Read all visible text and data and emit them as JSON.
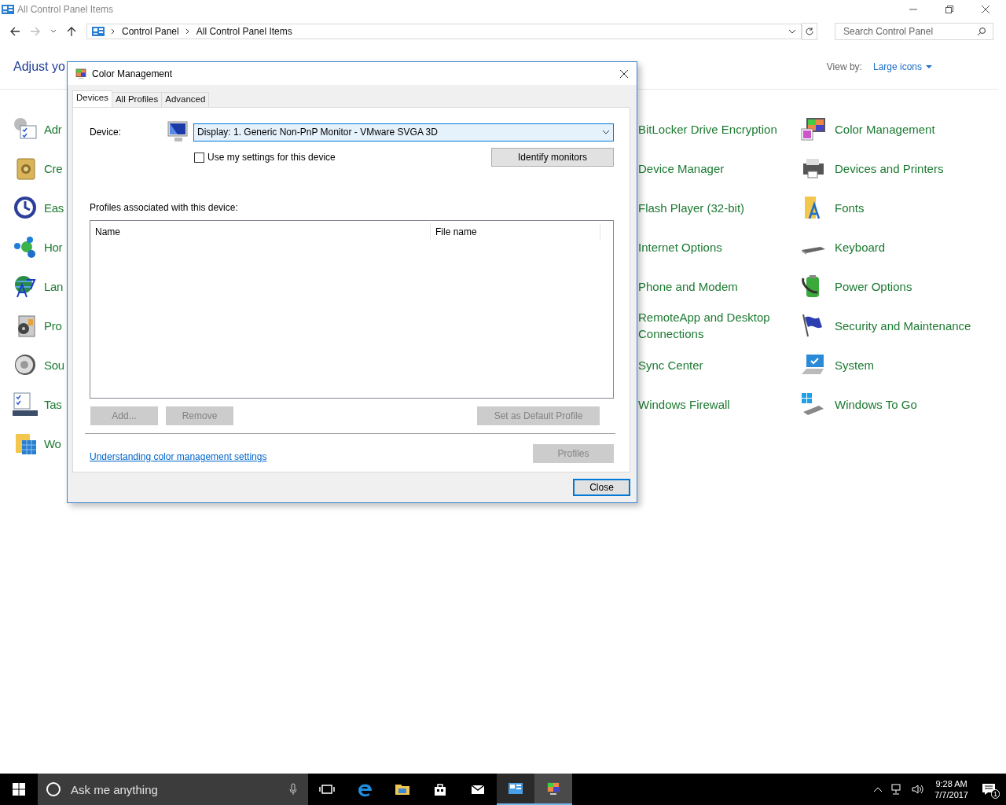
{
  "window": {
    "title": "All Control Panel Items"
  },
  "address_bar": {
    "breadcrumbs": [
      "Control Panel",
      "All Control Panel Items"
    ]
  },
  "search": {
    "placeholder": "Search Control Panel"
  },
  "header": {
    "title": "Adjust yo",
    "view_by_label": "View by:",
    "view_by_value": "Large icons"
  },
  "items_column_1": [
    "Adr",
    "Cre",
    "Eas",
    "Hor",
    "Lan",
    "Pro",
    "Sou",
    "Tas",
    "Wo"
  ],
  "items_column_3": [
    "BitLocker Drive Encryption",
    "Device Manager",
    "Flash Player (32-bit)",
    "Internet Options",
    "Phone and Modem",
    "RemoteApp and Desktop Connections",
    "Sync Center",
    "Windows Firewall"
  ],
  "items_column_4": [
    "Color Management",
    "Devices and Printers",
    "Fonts",
    "Keyboard",
    "Power Options",
    "Security and Maintenance",
    "System",
    "Windows To Go"
  ],
  "dialog": {
    "title": "Color Management",
    "tabs": [
      {
        "label": "Devices",
        "selected": true
      },
      {
        "label": "All Profiles",
        "selected": false
      },
      {
        "label": "Advanced",
        "selected": false
      }
    ],
    "device_label": "Device:",
    "device_value": "Display: 1. Generic Non-PnP Monitor - VMware SVGA 3D",
    "use_settings": {
      "label": "Use my settings for this device",
      "checked": false
    },
    "identify_button": "Identify monitors",
    "profiles_label": "Profiles associated with this device:",
    "columns": [
      "Name",
      "File name"
    ],
    "profile_buttons": [
      {
        "label": "Add...",
        "disabled": true
      },
      {
        "label": "Remove",
        "disabled": true
      },
      {
        "label": "Set as Default Profile",
        "disabled": true
      }
    ],
    "link": "Understanding color management settings",
    "profiles_button": {
      "label": "Profiles",
      "disabled": true
    },
    "close_button": "Close"
  },
  "taskbar": {
    "search_placeholder": "Ask me anything",
    "apps": [
      {
        "running": false,
        "selected": false
      },
      {
        "running": false,
        "selected": false
      },
      {
        "running": false,
        "selected": false
      },
      {
        "running": false,
        "selected": false
      },
      {
        "running": false,
        "selected": false
      },
      {
        "running": true,
        "selected": false
      },
      {
        "running": true,
        "selected": true
      }
    ],
    "time": "9:28 AM",
    "date": "7/7/2017",
    "notifications": "1"
  }
}
